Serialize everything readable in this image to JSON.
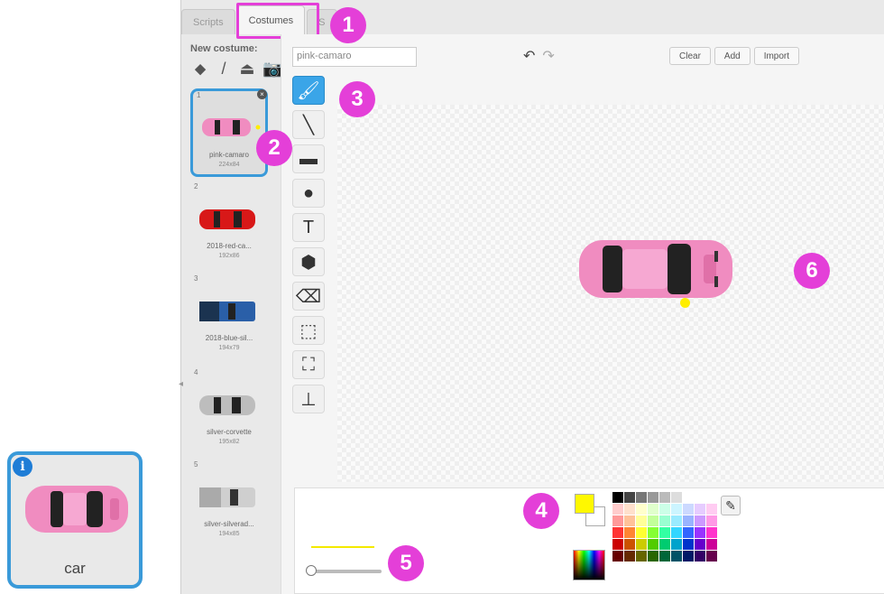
{
  "sprite": {
    "name": "car",
    "info_icon": "i"
  },
  "tabs": [
    {
      "label": "Scripts",
      "active": false
    },
    {
      "label": "Costumes",
      "active": true
    },
    {
      "label": "S",
      "active": false
    }
  ],
  "new_costume": {
    "label": "New costume:",
    "tools": [
      "paint-icon",
      "brush-icon",
      "upload-icon",
      "camera-icon"
    ]
  },
  "costumes": [
    {
      "num": "1",
      "name": "pink-camaro",
      "size": "224x84",
      "color": "#f08cc0",
      "selected": true
    },
    {
      "num": "2",
      "name": "2018-red-ca...",
      "size": "192x86",
      "color": "#d81818",
      "selected": false
    },
    {
      "num": "3",
      "name": "2018-blue-sil...",
      "size": "194x79",
      "color": "#2a5fa8",
      "selected": false
    },
    {
      "num": "4",
      "name": "silver-corvette",
      "size": "195x82",
      "color": "#b8b8b8",
      "selected": false
    },
    {
      "num": "5",
      "name": "silver-silverad...",
      "size": "194x85",
      "color": "#c8c8c8",
      "selected": false
    }
  ],
  "editor": {
    "costume_name": "pink-camaro",
    "undo_icon": "↶",
    "redo_icon": "↷",
    "buttons": {
      "clear": "Clear",
      "add": "Add",
      "import": "Import"
    },
    "tools": [
      {
        "name": "brush-icon",
        "glyph": "🖌",
        "active": true
      },
      {
        "name": "line-icon",
        "glyph": "╲",
        "active": false
      },
      {
        "name": "rectangle-icon",
        "glyph": "▬",
        "active": false
      },
      {
        "name": "ellipse-icon",
        "glyph": "●",
        "active": false
      },
      {
        "name": "text-icon",
        "glyph": "T",
        "active": false
      },
      {
        "name": "fill-icon",
        "glyph": "⬢",
        "active": false
      },
      {
        "name": "eraser-icon",
        "glyph": "⌫",
        "active": false
      },
      {
        "name": "select-icon",
        "glyph": "⬚",
        "active": false
      },
      {
        "name": "select-remove-bg-icon",
        "glyph": "⛶",
        "active": false
      },
      {
        "name": "stamp-icon",
        "glyph": "⊥",
        "active": false
      }
    ]
  },
  "colors": {
    "accent": "#3a9ad9",
    "annotation": "#e43fd8",
    "primary_color": "#fff800",
    "secondary_color": "#ffffff",
    "car_pink": "#f08cc0"
  },
  "palette": [
    "#000000",
    "#444444",
    "#777777",
    "#999999",
    "#bbbbbb",
    "#dddddd",
    "#ffffff",
    "#ffffff",
    "#ffffff",
    "#ffcccc",
    "#ffe0cc",
    "#ffffcc",
    "#e0ffcc",
    "#ccffe8",
    "#ccf5ff",
    "#ccd9ff",
    "#e6ccff",
    "#ffccf2",
    "#ff9999",
    "#ffc299",
    "#ffff99",
    "#c2ff99",
    "#99ffd1",
    "#99ebff",
    "#99b3ff",
    "#cc99ff",
    "#ff99e6",
    "#ff3333",
    "#ff8533",
    "#ffff33",
    "#85ff33",
    "#33ffa3",
    "#33d6ff",
    "#3366ff",
    "#9933ff",
    "#ff33cc",
    "#cc0000",
    "#cc5200",
    "#cccc00",
    "#52cc00",
    "#00cc70",
    "#00a3cc",
    "#0033cc",
    "#6600cc",
    "#cc0099",
    "#660000",
    "#662900",
    "#666600",
    "#296600",
    "#006638",
    "#005266",
    "#001966",
    "#330066",
    "#66004d"
  ],
  "annotations": [
    "1",
    "2",
    "3",
    "4",
    "5",
    "6"
  ]
}
